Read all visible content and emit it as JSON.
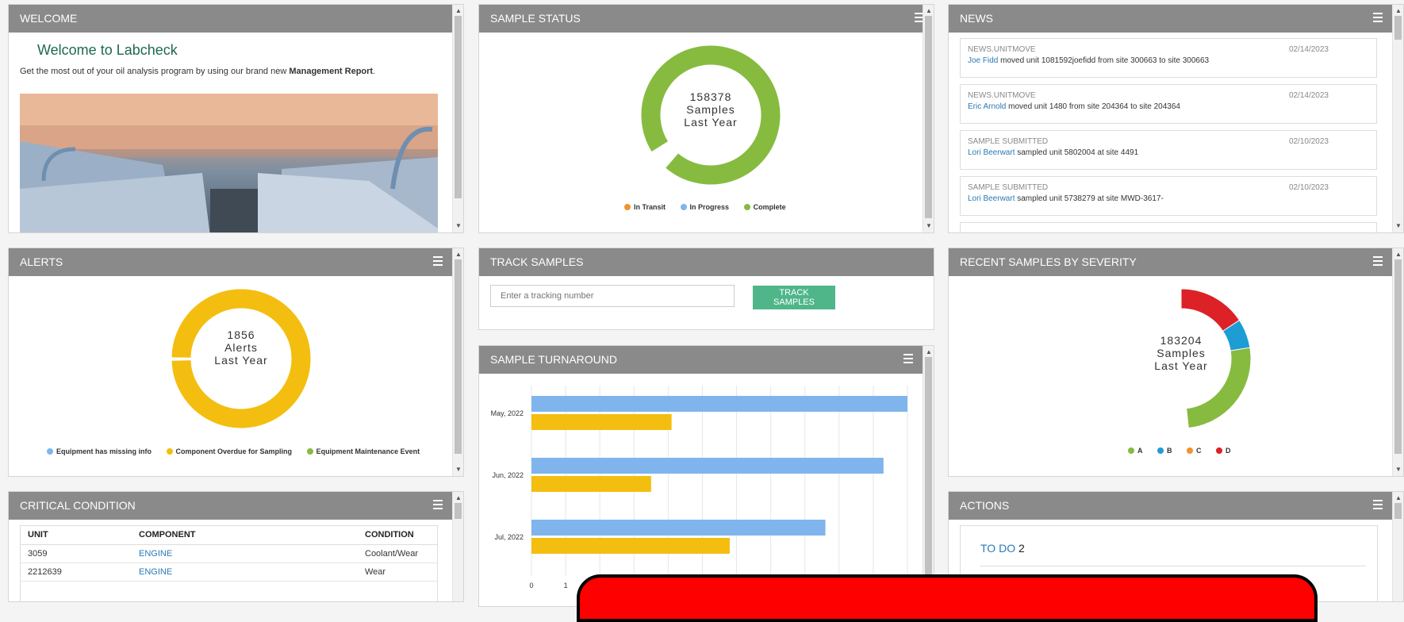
{
  "welcome": {
    "header": "WELCOME",
    "title": "Welcome to Labcheck",
    "text_prefix": "Get the most out of your oil analysis program by using our brand new ",
    "text_bold": "Management Report",
    "text_suffix": "."
  },
  "sample_status": {
    "header": "SAMPLE STATUS",
    "center_number": "158378",
    "center_line2": "Samples",
    "center_line3": "Last Year",
    "legend": [
      {
        "label": "In Transit",
        "color": "#f0932b"
      },
      {
        "label": "In Progress",
        "color": "#7fb5ec"
      },
      {
        "label": "Complete",
        "color": "#86bb40"
      }
    ]
  },
  "news": {
    "header": "NEWS",
    "items": [
      {
        "type": "NEWS.UNITMOVE",
        "date": "02/14/2023",
        "who": "Joe Fidd",
        "text": " moved unit 1081592joefidd from site 300663 to site 300663"
      },
      {
        "type": "NEWS.UNITMOVE",
        "date": "02/14/2023",
        "who": "Eric Arnold",
        "text": " moved unit 1480 from site 204364 to site 204364"
      },
      {
        "type": "SAMPLE SUBMITTED",
        "date": "02/10/2023",
        "who": "Lori Beerwart",
        "text": " sampled unit 5802004 at site 4491"
      },
      {
        "type": "SAMPLE SUBMITTED",
        "date": "02/10/2023",
        "who": "Lori Beerwart",
        "text": " sampled unit 5738279 at site MWD-3617-"
      }
    ]
  },
  "alerts": {
    "header": "ALERTS",
    "center_number": "1856",
    "center_line2": "Alerts",
    "center_line3": "Last Year",
    "legend": [
      {
        "label": "Equipment has missing info",
        "color": "#7fb5ec"
      },
      {
        "label": "Component Overdue for Sampling",
        "color": "#f4be10"
      },
      {
        "label": "Equipment Maintenance Event",
        "color": "#86bb40"
      }
    ]
  },
  "track": {
    "header": "TRACK SAMPLES",
    "placeholder": "Enter a tracking number",
    "button": "TRACK SAMPLES"
  },
  "turnaround": {
    "header": "SAMPLE TURNAROUND"
  },
  "severity": {
    "header": "RECENT SAMPLES BY SEVERITY",
    "center_number": "183204",
    "center_line2": "Samples",
    "center_line3": "Last Year",
    "legend": [
      {
        "label": "A",
        "color": "#86bb40"
      },
      {
        "label": "B",
        "color": "#1d9dd3"
      },
      {
        "label": "C",
        "color": "#f0932b"
      },
      {
        "label": "D",
        "color": "#dc2127"
      }
    ]
  },
  "critical": {
    "header": "CRITICAL CONDITION",
    "columns": [
      "UNIT",
      "COMPONENT",
      "CONDITION"
    ],
    "rows": [
      [
        "3059",
        "ENGINE",
        "Coolant/Wear"
      ],
      [
        "2212639",
        "ENGINE",
        "Wear"
      ]
    ]
  },
  "actions": {
    "header": "ACTIONS",
    "todo_label": "TO DO",
    "todo_count": "2"
  },
  "chart_data": [
    {
      "type": "pie",
      "title": "",
      "labels": [
        "In Transit",
        "In Progress",
        "Complete"
      ],
      "values": [
        0.3,
        4.5,
        95.2
      ]
    },
    {
      "type": "pie",
      "title": "",
      "labels": [
        "Equipment has missing info",
        "Component Overdue for Sampling",
        "Equipment Maintenance Event"
      ],
      "values": [
        0.2,
        99.6,
        0.2
      ]
    },
    {
      "type": "pie",
      "title": "",
      "labels": [
        "A",
        "B",
        "C",
        "D"
      ],
      "values": [
        43,
        20,
        12,
        14
      ]
    },
    {
      "type": "bar",
      "orientation": "horizontal",
      "categories": [
        "May, 2022",
        "Jun, 2022",
        "Jul, 2022"
      ],
      "series": [
        {
          "values": [
            11,
            10.3,
            8.6
          ],
          "color": "#7fb5ec"
        },
        {
          "values": [
            4.1,
            3.5,
            5.8
          ],
          "color": "#f4be10"
        }
      ],
      "x_ticks": [
        "0",
        "1"
      ],
      "xlim": [
        0,
        11
      ]
    }
  ]
}
